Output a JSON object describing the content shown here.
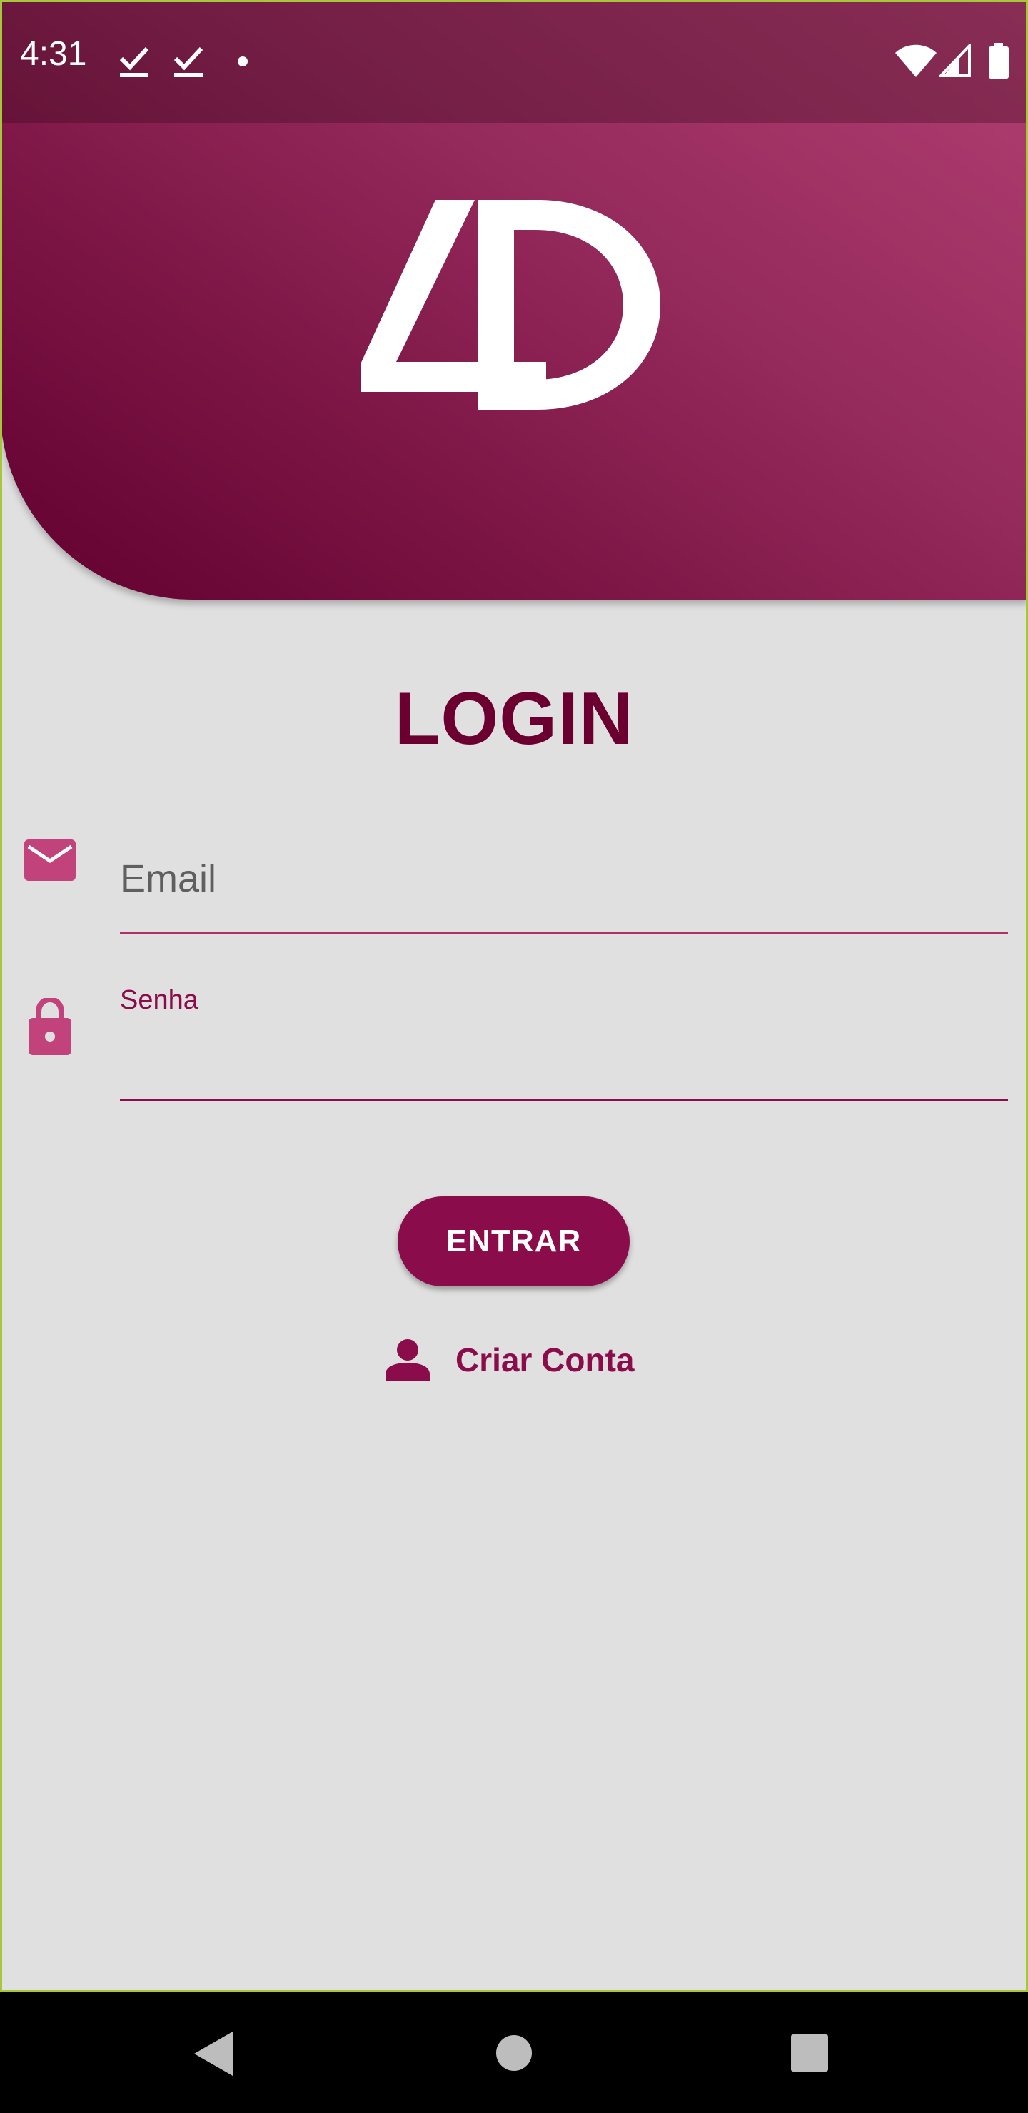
{
  "status_bar": {
    "time": "4:31",
    "icons": [
      "check-icon",
      "check-icon",
      "dot-icon",
      "wifi-icon",
      "signal-icon",
      "battery-icon"
    ]
  },
  "header": {
    "logo_text": "4D",
    "gradient_colors": [
      "#b23f72",
      "#620030"
    ]
  },
  "login": {
    "title": "LOGIN",
    "email": {
      "placeholder": "Email",
      "value": "",
      "icon": "mail-icon"
    },
    "password": {
      "label": "Senha",
      "value": "",
      "icon": "lock-icon"
    },
    "submit_label": "ENTRAR",
    "create_account_label": "Criar Conta",
    "create_account_icon": "person-icon"
  },
  "nav_bar": {
    "buttons": [
      "back-icon",
      "home-icon",
      "recents-icon"
    ]
  },
  "colors": {
    "primary": "#8a0c4b",
    "title": "#6b0030",
    "icon_accent": "#c2427c",
    "background": "#e0e0e0"
  }
}
